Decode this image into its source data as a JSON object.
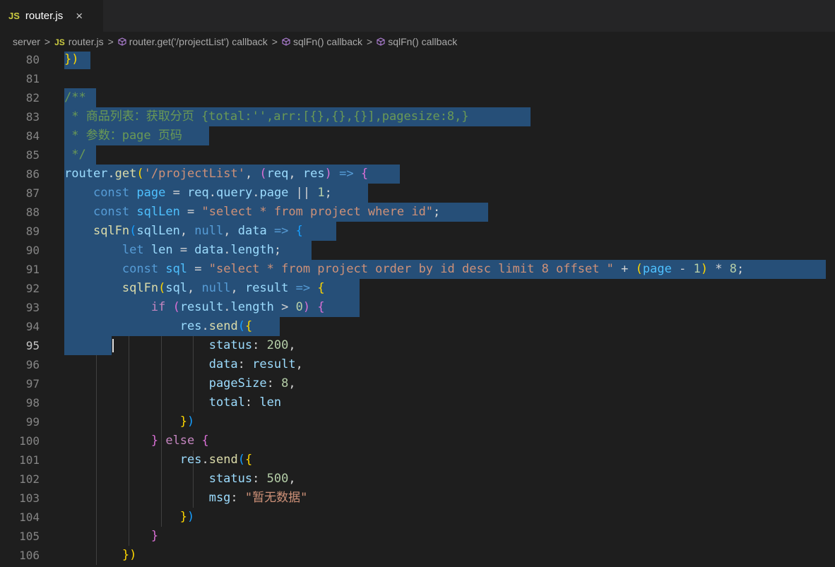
{
  "tab": {
    "badge": "JS",
    "title": "router.js",
    "close": "×"
  },
  "breadcrumb": {
    "items": [
      "server",
      "router.js",
      "router.get('/projectList') callback",
      "sqlFn() callback",
      "sqlFn() callback"
    ],
    "js_badge": "JS",
    "separator": ">"
  },
  "editor": {
    "active_line": 95,
    "lines": [
      {
        "n": "80",
        "tokens": [
          [
            "brk1",
            "})"
          ]
        ]
      },
      {
        "n": "81",
        "tokens": []
      },
      {
        "n": "82",
        "tokens": [
          [
            "cm",
            "/**"
          ]
        ]
      },
      {
        "n": "83",
        "tokens": [
          [
            "cm",
            " * 商品列表：获取分页 {total:'',arr:[{},{},{}],pagesize:8,}"
          ]
        ]
      },
      {
        "n": "84",
        "tokens": [
          [
            "cm",
            " * 参数：page 页码"
          ]
        ]
      },
      {
        "n": "85",
        "tokens": [
          [
            "cm",
            " */"
          ]
        ]
      },
      {
        "n": "86",
        "tokens": [
          [
            "var",
            "router"
          ],
          [
            "plain",
            "."
          ],
          [
            "fn",
            "get"
          ],
          [
            "brk1",
            "("
          ],
          [
            "str",
            "'/projectList'"
          ],
          [
            "plain",
            ", "
          ],
          [
            "brk2",
            "("
          ],
          [
            "var",
            "req"
          ],
          [
            "plain",
            ", "
          ],
          [
            "var",
            "res"
          ],
          [
            "brk2",
            ")"
          ],
          [
            "plain",
            " "
          ],
          [
            "kw",
            "=>"
          ],
          [
            "plain",
            " "
          ],
          [
            "brk2",
            "{"
          ]
        ]
      },
      {
        "n": "87",
        "tokens": [
          [
            "plain",
            "    "
          ],
          [
            "kw",
            "const"
          ],
          [
            "plain",
            " "
          ],
          [
            "cst",
            "page"
          ],
          [
            "plain",
            " = "
          ],
          [
            "var",
            "req"
          ],
          [
            "plain",
            "."
          ],
          [
            "var",
            "query"
          ],
          [
            "plain",
            "."
          ],
          [
            "var",
            "page"
          ],
          [
            "plain",
            " || "
          ],
          [
            "num",
            "1"
          ],
          [
            "plain",
            ";"
          ]
        ]
      },
      {
        "n": "88",
        "tokens": [
          [
            "plain",
            "    "
          ],
          [
            "kw",
            "const"
          ],
          [
            "plain",
            " "
          ],
          [
            "cst",
            "sqlLen"
          ],
          [
            "plain",
            " = "
          ],
          [
            "str",
            "\"select * from project where id\""
          ],
          [
            "plain",
            ";"
          ]
        ]
      },
      {
        "n": "89",
        "tokens": [
          [
            "plain",
            "    "
          ],
          [
            "fn",
            "sqlFn"
          ],
          [
            "brk3",
            "("
          ],
          [
            "var",
            "sqlLen"
          ],
          [
            "plain",
            ", "
          ],
          [
            "kw",
            "null"
          ],
          [
            "plain",
            ", "
          ],
          [
            "var",
            "data"
          ],
          [
            "plain",
            " "
          ],
          [
            "kw",
            "=>"
          ],
          [
            "plain",
            " "
          ],
          [
            "brk3",
            "{"
          ]
        ]
      },
      {
        "n": "90",
        "tokens": [
          [
            "plain",
            "        "
          ],
          [
            "kw",
            "let"
          ],
          [
            "plain",
            " "
          ],
          [
            "var",
            "len"
          ],
          [
            "plain",
            " = "
          ],
          [
            "var",
            "data"
          ],
          [
            "plain",
            "."
          ],
          [
            "var",
            "length"
          ],
          [
            "plain",
            ";"
          ]
        ]
      },
      {
        "n": "91",
        "tokens": [
          [
            "plain",
            "        "
          ],
          [
            "kw",
            "const"
          ],
          [
            "plain",
            " "
          ],
          [
            "cst",
            "sql"
          ],
          [
            "plain",
            " = "
          ],
          [
            "str",
            "\"select * from project order by id desc limit 8 offset \""
          ],
          [
            "plain",
            " + "
          ],
          [
            "brk1",
            "("
          ],
          [
            "cst",
            "page"
          ],
          [
            "plain",
            " - "
          ],
          [
            "num",
            "1"
          ],
          [
            "brk1",
            ")"
          ],
          [
            "plain",
            " * "
          ],
          [
            "num",
            "8"
          ],
          [
            "plain",
            ";"
          ]
        ]
      },
      {
        "n": "92",
        "tokens": [
          [
            "plain",
            "        "
          ],
          [
            "fn",
            "sqlFn"
          ],
          [
            "brk1",
            "("
          ],
          [
            "var",
            "sql"
          ],
          [
            "plain",
            ", "
          ],
          [
            "kw",
            "null"
          ],
          [
            "plain",
            ", "
          ],
          [
            "var",
            "result"
          ],
          [
            "plain",
            " "
          ],
          [
            "kw",
            "=>"
          ],
          [
            "plain",
            " "
          ],
          [
            "brk1",
            "{"
          ]
        ]
      },
      {
        "n": "93",
        "tokens": [
          [
            "plain",
            "            "
          ],
          [
            "kw2",
            "if"
          ],
          [
            "plain",
            " "
          ],
          [
            "brk2",
            "("
          ],
          [
            "var",
            "result"
          ],
          [
            "plain",
            "."
          ],
          [
            "var",
            "length"
          ],
          [
            "plain",
            " > "
          ],
          [
            "num",
            "0"
          ],
          [
            "brk2",
            ")"
          ],
          [
            "plain",
            " "
          ],
          [
            "brk2",
            "{"
          ]
        ]
      },
      {
        "n": "94",
        "tokens": [
          [
            "plain",
            "                "
          ],
          [
            "var",
            "res"
          ],
          [
            "plain",
            "."
          ],
          [
            "fn",
            "send"
          ],
          [
            "brk3",
            "("
          ],
          [
            "brk1",
            "{"
          ]
        ]
      },
      {
        "n": "95",
        "tokens": [
          [
            "plain",
            "                    "
          ],
          [
            "var",
            "status"
          ],
          [
            "plain",
            ": "
          ],
          [
            "num",
            "200"
          ],
          [
            "plain",
            ","
          ]
        ]
      },
      {
        "n": "96",
        "tokens": [
          [
            "plain",
            "                    "
          ],
          [
            "var",
            "data"
          ],
          [
            "plain",
            ": "
          ],
          [
            "var",
            "result"
          ],
          [
            "plain",
            ","
          ]
        ]
      },
      {
        "n": "97",
        "tokens": [
          [
            "plain",
            "                    "
          ],
          [
            "var",
            "pageSize"
          ],
          [
            "plain",
            ": "
          ],
          [
            "num",
            "8"
          ],
          [
            "plain",
            ","
          ]
        ]
      },
      {
        "n": "98",
        "tokens": [
          [
            "plain",
            "                    "
          ],
          [
            "var",
            "total"
          ],
          [
            "plain",
            ": "
          ],
          [
            "var",
            "len"
          ]
        ]
      },
      {
        "n": "99",
        "tokens": [
          [
            "plain",
            "                "
          ],
          [
            "brk1",
            "}"
          ],
          [
            "brk3",
            ")"
          ]
        ]
      },
      {
        "n": "100",
        "tokens": [
          [
            "plain",
            "            "
          ],
          [
            "brk2",
            "}"
          ],
          [
            "plain",
            " "
          ],
          [
            "kw2",
            "else"
          ],
          [
            "plain",
            " "
          ],
          [
            "brk2",
            "{"
          ]
        ]
      },
      {
        "n": "101",
        "tokens": [
          [
            "plain",
            "                "
          ],
          [
            "var",
            "res"
          ],
          [
            "plain",
            "."
          ],
          [
            "fn",
            "send"
          ],
          [
            "brk3",
            "("
          ],
          [
            "brk1",
            "{"
          ]
        ]
      },
      {
        "n": "102",
        "tokens": [
          [
            "plain",
            "                    "
          ],
          [
            "var",
            "status"
          ],
          [
            "plain",
            ": "
          ],
          [
            "num",
            "500"
          ],
          [
            "plain",
            ","
          ]
        ]
      },
      {
        "n": "103",
        "tokens": [
          [
            "plain",
            "                    "
          ],
          [
            "var",
            "msg"
          ],
          [
            "plain",
            ": "
          ],
          [
            "str",
            "\"暂无数据\""
          ]
        ]
      },
      {
        "n": "104",
        "tokens": [
          [
            "plain",
            "                "
          ],
          [
            "brk1",
            "}"
          ],
          [
            "brk3",
            ")"
          ]
        ]
      },
      {
        "n": "105",
        "tokens": [
          [
            "plain",
            "            "
          ],
          [
            "brk2",
            "}"
          ]
        ]
      },
      {
        "n": "106",
        "tokens": [
          [
            "plain",
            "        "
          ],
          [
            "brk1",
            "}"
          ],
          [
            "brk1",
            ")"
          ]
        ]
      }
    ]
  }
}
